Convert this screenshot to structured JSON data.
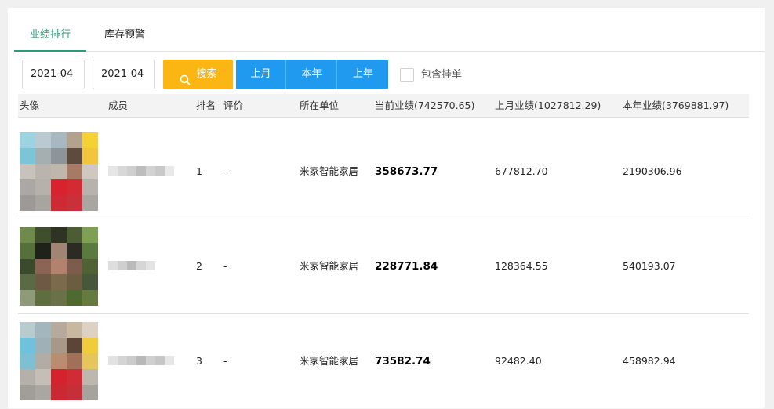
{
  "tabs": [
    {
      "label": "业绩排行"
    },
    {
      "label": "库存预警"
    }
  ],
  "filters": {
    "start_date": "2021-04",
    "end_date": "2021-04",
    "search_label": "搜索",
    "period_buttons": [
      "上月",
      "本年",
      "上年"
    ],
    "include_pending_label": "包含挂单",
    "include_pending_checked": false
  },
  "table": {
    "headers": {
      "avatar": "头像",
      "member": "成员",
      "rank": "排名",
      "rating": "评价",
      "unit": "所在单位",
      "current": "当前业绩(742570.65)",
      "last_month": "上月业绩(1027812.29)",
      "this_year": "本年业绩(3769881.97)"
    },
    "rows": [
      {
        "rank": "1",
        "rating": "-",
        "unit": "米家智能家居",
        "current": "358673.77",
        "last_month": "677812.70",
        "this_year": "2190306.96"
      },
      {
        "rank": "2",
        "rating": "-",
        "unit": "米家智能家居",
        "current": "228771.84",
        "last_month": "128364.55",
        "this_year": "540193.07"
      },
      {
        "rank": "3",
        "rating": "-",
        "unit": "米家智能家居",
        "current": "73582.74",
        "last_month": "92482.40",
        "this_year": "458982.94"
      }
    ]
  },
  "colors": {
    "accent_green": "#2a9d74",
    "search_yellow": "#fbb614",
    "button_blue": "#1f9aef"
  }
}
